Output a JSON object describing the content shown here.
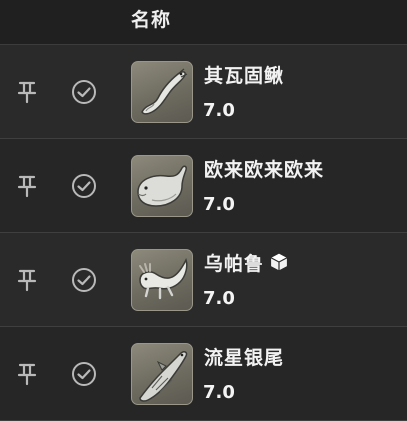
{
  "header": {
    "name_column": "名称"
  },
  "items": [
    {
      "name": "其瓦固鳅",
      "value": "7.0",
      "icon": "loach-fish-icon",
      "badge": ""
    },
    {
      "name": "欧来欧来欧来",
      "value": "7.0",
      "icon": "pufferfish-icon",
      "badge": ""
    },
    {
      "name": "乌帕鲁",
      "value": "7.0",
      "icon": "axolotl-icon",
      "badge": "cube-badge-icon"
    },
    {
      "name": "流星银尾",
      "value": "7.0",
      "icon": "silver-tail-fish-icon",
      "badge": ""
    }
  ]
}
